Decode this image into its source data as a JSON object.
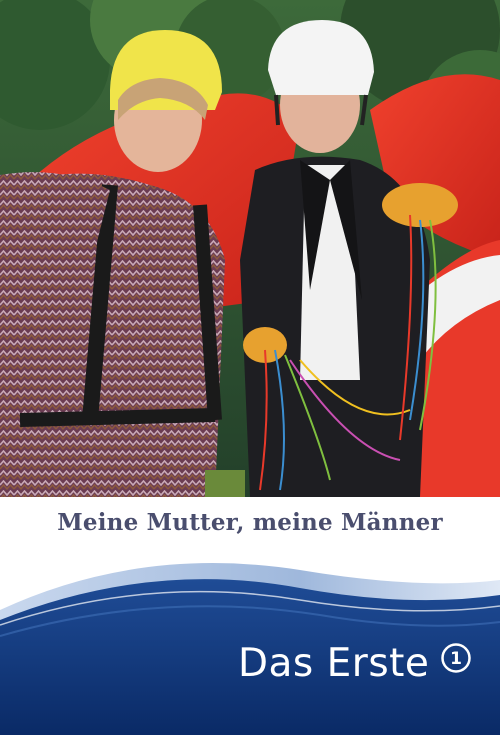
{
  "poster": {
    "title": "Meine Mutter, meine Männer",
    "broadcaster": "Das Erste",
    "broadcaster_logo_number": "1"
  },
  "colors": {
    "title_text": "#4a4e6e",
    "wave_dark": "#0a2a66",
    "wave_mid": "#1f4c96",
    "wave_light": "#9fb8dc",
    "brand_text": "#ffffff"
  },
  "icons": {
    "broadcaster_logo": "das-erste-one-icon"
  }
}
